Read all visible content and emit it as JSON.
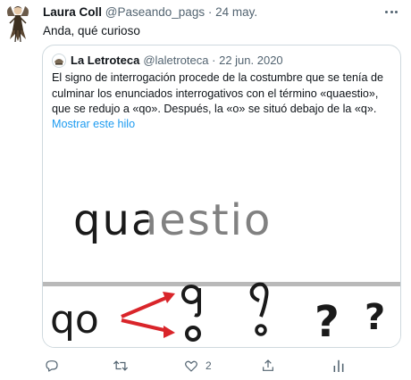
{
  "tweet": {
    "author_name": "Laura Coll",
    "author_handle": "@Paseando_pags",
    "separator": "·",
    "date": "24 may.",
    "text": "Anda, qué curioso"
  },
  "quoted": {
    "author_name": "La Letroteca",
    "author_handle": "@laletroteca",
    "separator": "·",
    "date": "22 jun. 2020",
    "text": "El signo de interrogación procede de la costumbre que se tenía de culminar los enunciados interrogativos con el término «quaestio», que se redujo a «qo». Después, la «o» se situó debajo de la «q».",
    "show_thread": "Mostrar este hilo",
    "image": {
      "word": "quaestio",
      "abbrev": "qo",
      "marks": [
        "?",
        "?"
      ]
    }
  },
  "actions": {
    "reply_icon": "reply-icon",
    "retweet_icon": "retweet-icon",
    "like_icon": "heart-icon",
    "like_count": "2",
    "share_icon": "share-icon",
    "analytics_icon": "analytics-icon"
  },
  "colors": {
    "accent": "#1d9bf0",
    "muted": "#536471",
    "border": "#cfd9de",
    "arrow": "#d9252a"
  }
}
